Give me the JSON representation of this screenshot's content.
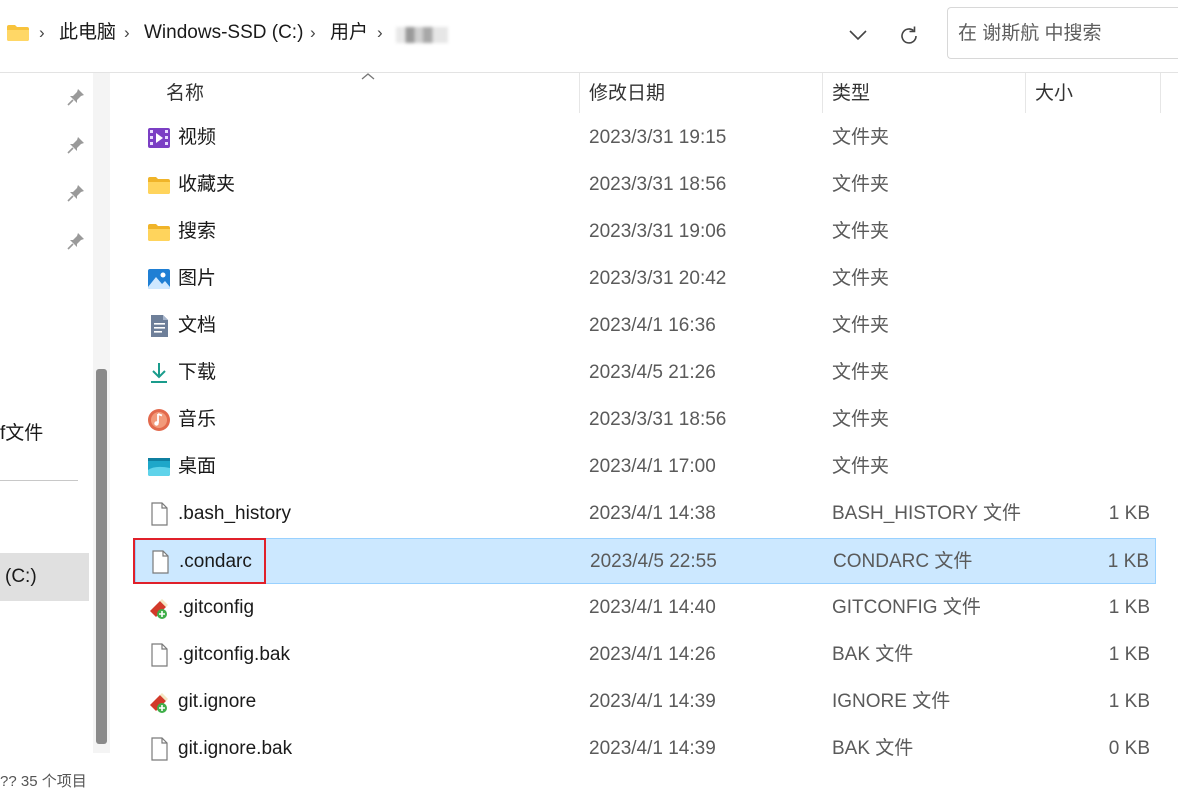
{
  "address_bar": {
    "crumbs": [
      "此电脑",
      "Windows-SSD (C:)",
      "用户"
    ]
  },
  "search": {
    "placeholder": "在 谢斯航 中搜索"
  },
  "nav_pane": {
    "truncated_item_label": "f文件",
    "drive_label": "(C:)",
    "status_text": "??  35 个项目"
  },
  "columns": {
    "name": "名称",
    "date": "修改日期",
    "type": "类型",
    "size": "大小"
  },
  "files": [
    {
      "name": "视频",
      "date": "2023/3/31 19:15",
      "type": "文件夹",
      "size": "",
      "icon": "videos-folder-icon"
    },
    {
      "name": "收藏夹",
      "date": "2023/3/31 18:56",
      "type": "文件夹",
      "size": "",
      "icon": "folder-icon"
    },
    {
      "name": "搜索",
      "date": "2023/3/31 19:06",
      "type": "文件夹",
      "size": "",
      "icon": "folder-icon"
    },
    {
      "name": "图片",
      "date": "2023/3/31 20:42",
      "type": "文件夹",
      "size": "",
      "icon": "pictures-folder-icon"
    },
    {
      "name": "文档",
      "date": "2023/4/1 16:36",
      "type": "文件夹",
      "size": "",
      "icon": "documents-folder-icon"
    },
    {
      "name": "下载",
      "date": "2023/4/5 21:26",
      "type": "文件夹",
      "size": "",
      "icon": "download-folder-icon"
    },
    {
      "name": "音乐",
      "date": "2023/3/31 18:56",
      "type": "文件夹",
      "size": "",
      "icon": "music-folder-icon"
    },
    {
      "name": "桌面",
      "date": "2023/4/1 17:00",
      "type": "文件夹",
      "size": "",
      "icon": "desktop-folder-icon"
    },
    {
      "name": ".bash_history",
      "date": "2023/4/1 14:38",
      "type": "BASH_HISTORY 文件",
      "size": "1 KB",
      "icon": "file-icon"
    },
    {
      "name": ".condarc",
      "date": "2023/4/5 22:55",
      "type": "CONDARC 文件",
      "size": "1 KB",
      "icon": "file-icon",
      "selected": true
    },
    {
      "name": ".gitconfig",
      "date": "2023/4/1 14:40",
      "type": "GITCONFIG 文件",
      "size": "1 KB",
      "icon": "git-file-icon"
    },
    {
      "name": ".gitconfig.bak",
      "date": "2023/4/1 14:26",
      "type": "BAK 文件",
      "size": "1 KB",
      "icon": "file-icon"
    },
    {
      "name": "git.ignore",
      "date": "2023/4/1 14:39",
      "type": "IGNORE 文件",
      "size": "1 KB",
      "icon": "git-file-icon"
    },
    {
      "name": "git.ignore.bak",
      "date": "2023/4/1 14:39",
      "type": "BAK 文件",
      "size": "0 KB",
      "icon": "file-icon"
    }
  ],
  "colors": {
    "selection_bg": "#cce8ff",
    "selection_border": "#99d1ff",
    "highlight_box": "#e0202a",
    "folder_yellow": "#f8c33c"
  }
}
